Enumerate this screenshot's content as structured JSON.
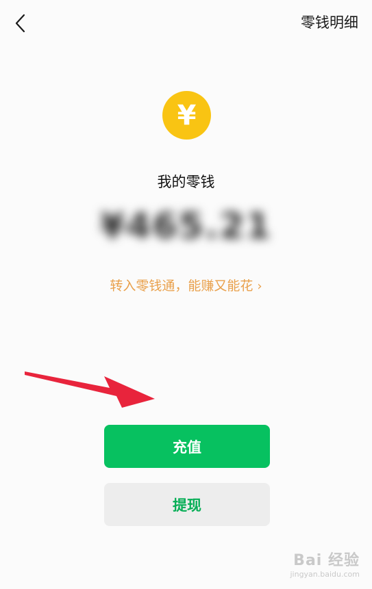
{
  "header": {
    "title": "零钱明细"
  },
  "coin": {
    "symbol": "¥"
  },
  "balance": {
    "label": "我的零钱",
    "amount": "¥465.21"
  },
  "promo": {
    "text": "转入零钱通，能赚又能花",
    "chevron": "›"
  },
  "actions": {
    "recharge_label": "充值",
    "withdraw_label": "提现"
  },
  "watermark": {
    "logo": "Bai 经验",
    "url": "jingyan.baidu.com"
  },
  "colors": {
    "accent_green": "#07c160",
    "coin_yellow": "#f9c413",
    "promo_orange": "#e9a04b",
    "annotation_arrow": "#e8243c"
  },
  "icons": {
    "back": "chevron-left-icon",
    "coin": "yuan-coin-icon",
    "annotation": "red-arrow-icon"
  }
}
